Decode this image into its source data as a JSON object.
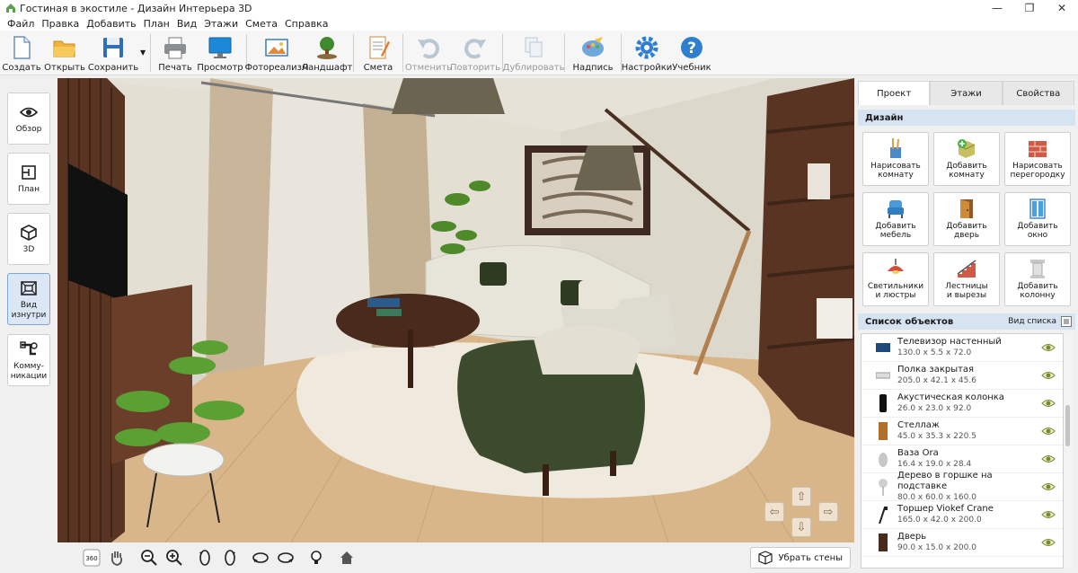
{
  "window": {
    "title": "Гостиная в экостиле - Дизайн Интерьера 3D"
  },
  "menu": [
    "Файл",
    "Правка",
    "Добавить",
    "План",
    "Вид",
    "Этажи",
    "Смета",
    "Справка"
  ],
  "toolbar": {
    "create": "Создать",
    "open": "Открыть",
    "save": "Сохранить",
    "print": "Печать",
    "preview": "Просмотр",
    "photorealism": "Фотореализм",
    "landscape": "Ландшафт",
    "estimate": "Смета",
    "undo": "Отменить",
    "redo": "Повторить",
    "duplicate": "Дублировать",
    "caption": "Надпись",
    "settings": "Настройки",
    "tutorial": "Учебник"
  },
  "left_panel": {
    "overview": "Обзор",
    "plan": "План",
    "view3d": "3D",
    "inside_line1": "Вид",
    "inside_line2": "изнутри",
    "utilities_line1": "Комму-",
    "utilities_line2": "никации"
  },
  "bottom_bar": {
    "remove_walls": "Убрать стены",
    "rotate_label": "360"
  },
  "right_panel": {
    "tabs": [
      "Проект",
      "Этажи",
      "Свойства"
    ],
    "design_header": "Дизайн",
    "design_buttons": [
      {
        "line1": "Нарисовать",
        "line2": "комнату"
      },
      {
        "line1": "Добавить",
        "line2": "комнату"
      },
      {
        "line1": "Нарисовать",
        "line2": "перегородку"
      },
      {
        "line1": "Добавить",
        "line2": "мебель"
      },
      {
        "line1": "Добавить",
        "line2": "дверь"
      },
      {
        "line1": "Добавить",
        "line2": "окно"
      },
      {
        "line1": "Светильники",
        "line2": "и люстры"
      },
      {
        "line1": "Лестницы",
        "line2": "и вырезы"
      },
      {
        "line1": "Добавить",
        "line2": "колонну"
      }
    ],
    "objects_header": "Список объектов",
    "list_view": "Вид списка",
    "objects": [
      {
        "name": "Телевизор настенный",
        "dims": "130.0 x 5.5 x 72.0"
      },
      {
        "name": "Полка закрытая",
        "dims": "205.0 x 42.1 x 45.6"
      },
      {
        "name": "Акустическая колонка",
        "dims": "26.0 x 23.0 x 92.0"
      },
      {
        "name": "Стеллаж",
        "dims": "45.0 x 35.3 x 220.5"
      },
      {
        "name": "Ваза Ora",
        "dims": "16.4 x 19.0 x 28.4"
      },
      {
        "name": "Дерево в горшке на подставке",
        "dims": "80.0 x 60.0 x 160.0"
      },
      {
        "name": "Торшер Viokef Crane",
        "dims": "165.0 x 42.0 x 200.0"
      },
      {
        "name": "Дверь",
        "dims": "90.0 x 15.0 x 200.0"
      }
    ]
  },
  "colors": {
    "accent": "#2f7fd0",
    "section_header": "#d6e3f1",
    "active_button": "#dce7f5",
    "sofa": "#e7e4da",
    "armchair": "#3c4a2d",
    "floor": "#d9b68a",
    "wall": "#e6e2d8",
    "eye_icon": "#7a8a2a"
  }
}
